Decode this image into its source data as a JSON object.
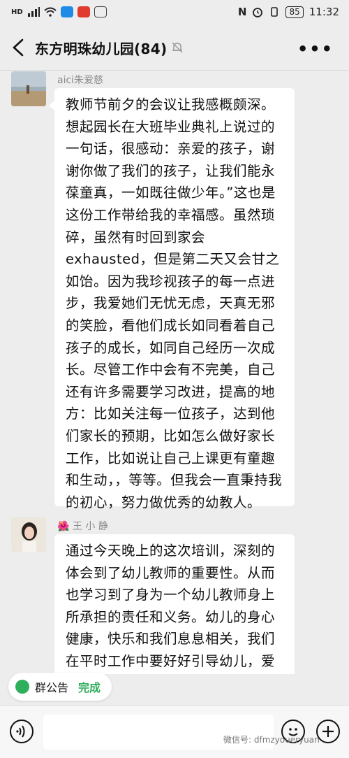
{
  "status_bar": {
    "network_left": "HD",
    "battery": "85",
    "time": "11:32",
    "nfc": "N"
  },
  "header": {
    "title": "东方明珠幼儿园(84)",
    "more": "•••"
  },
  "messages": [
    {
      "sender": "aici朱爱慈",
      "text": "教师节前夕的会议让我感概颇深。想起园长在大班毕业典礼上说过的一句话，很感动：亲爱的孩子，谢谢你做了我们的孩子，让我们能永葆童真，一如既往做少年。”这也是这份工作带给我的幸福感。虽然琐碎，虽然有时回到家会exhausted，但是第二天又会甘之如饴。因为我珍视孩子的每一点进步，我爱她们无忧无虑，天真无邪的笑脸，看他们成长如同看着自己孩子的成长，如同自己经历一次成长。尽管工作中会有不完美，自己还有许多需要学习改进，提高的地方：比如关注每一位孩子，达到他们家长的预期，比如怎么做好家长工作，比如说让自己上课更有童趣和生动，，等等。但我会一直秉持我的初心，努力做优秀的幼教人。"
    },
    {
      "sender_prefix": "🌺",
      "sender": "王 小 静",
      "text": "通过今天晚上的这次培训，深刻的体会到了幼儿教师的重要性。从而也学习到了身为一个幼儿教师身上所承担的责任和义务。幼儿的身心健康，快乐和我们息息相关，我们在平时工作中要好好引导幼儿，爱"
    }
  ],
  "notice": {
    "label": "群公告",
    "done": "完成"
  },
  "watermark": "微信号: dfmzyoueryuan",
  "colors": {
    "accent": "#2fae5b",
    "background": "#ededed",
    "bubble": "#ffffff"
  }
}
